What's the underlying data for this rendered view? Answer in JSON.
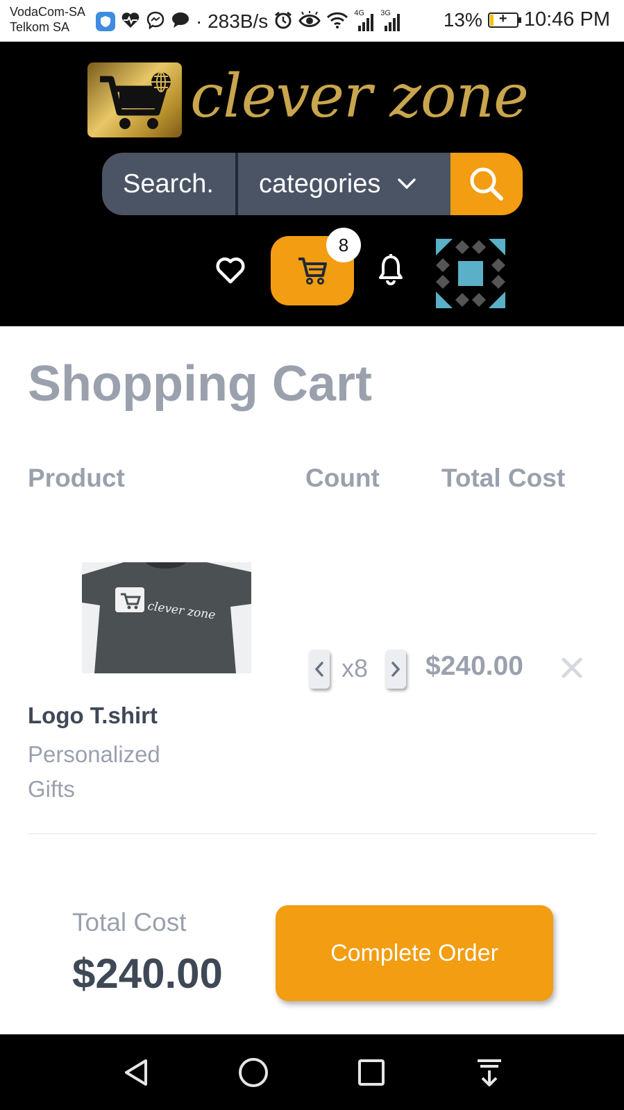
{
  "status_bar": {
    "carrier_1": "VodaCom-SA",
    "carrier_2": "Telkom SA",
    "net_speed": "283B/s",
    "network_4g": "4G",
    "network_3g": "3G",
    "battery": "13%",
    "time": "10:46 PM"
  },
  "header": {
    "logo_text": "clever zone",
    "search_placeholder": "Search.",
    "category_label": "categories",
    "cart_count": "8",
    "accent_color": "#f29d12"
  },
  "page": {
    "title": "Shopping Cart",
    "columns": [
      "Product",
      "Count",
      "Total Cost"
    ]
  },
  "cart_items": [
    {
      "name": "Logo T.shirt",
      "subtitle": "Personalized Gifts",
      "image_text": "clever zone",
      "quantity": "x8",
      "total": "$240.00"
    }
  ],
  "summary": {
    "label": "Total Cost",
    "value": "$240.00",
    "button": "Complete Order"
  },
  "icons": [
    "shield-icon",
    "heartbeat-icon",
    "messenger-icon",
    "chat-icon",
    "alarm-icon",
    "eye-icon",
    "wifi-icon",
    "signal-icon",
    "search-icon",
    "chevron-down-icon",
    "heart-icon",
    "cart-icon",
    "bell-icon",
    "chevron-left-icon",
    "chevron-right-icon",
    "close-icon",
    "back-icon",
    "home-icon",
    "recents-icon",
    "notification-drawer-icon"
  ]
}
